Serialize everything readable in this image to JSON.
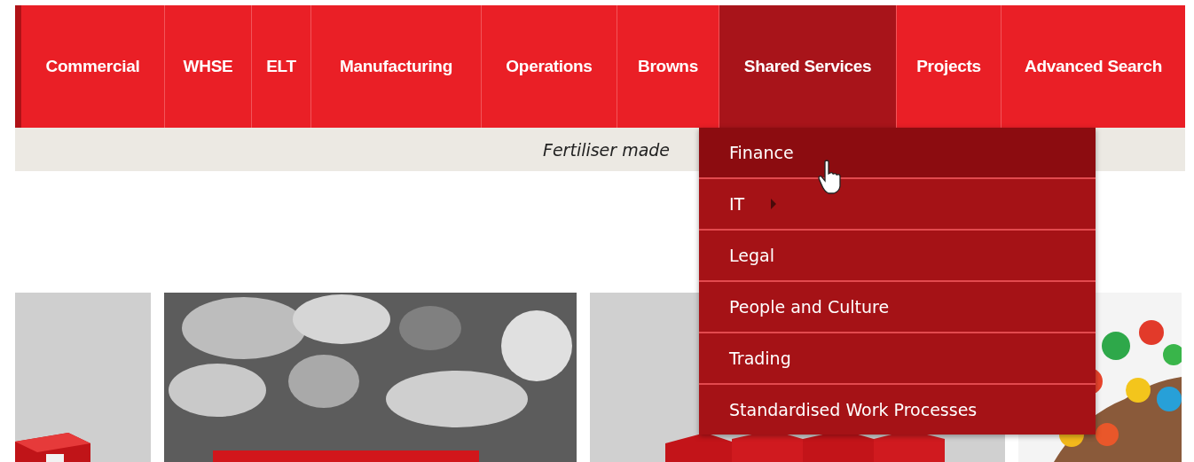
{
  "nav": {
    "items": [
      {
        "label": "Commercial",
        "selected": false
      },
      {
        "label": "WHSE",
        "selected": false
      },
      {
        "label": "ELT",
        "selected": false
      },
      {
        "label": "Manufacturing",
        "selected": false
      },
      {
        "label": "Operations",
        "selected": false
      },
      {
        "label": "Browns",
        "selected": false
      },
      {
        "label": "Shared Services",
        "selected": true
      },
      {
        "label": "Projects",
        "selected": false
      },
      {
        "label": "Advanced Search",
        "selected": false
      }
    ]
  },
  "banner": {
    "text": "Fertiliser made"
  },
  "dropdown": {
    "items": [
      {
        "label": "Finance",
        "selected": true,
        "has_submenu": false
      },
      {
        "label": "IT",
        "selected": false,
        "has_submenu": true
      },
      {
        "label": "Legal",
        "selected": false,
        "has_submenu": false
      },
      {
        "label": "People and Culture",
        "selected": false,
        "has_submenu": false
      },
      {
        "label": "Trading",
        "selected": false,
        "has_submenu": false
      },
      {
        "label": "Standardised Work Processes",
        "selected": false,
        "has_submenu": false
      }
    ]
  }
}
